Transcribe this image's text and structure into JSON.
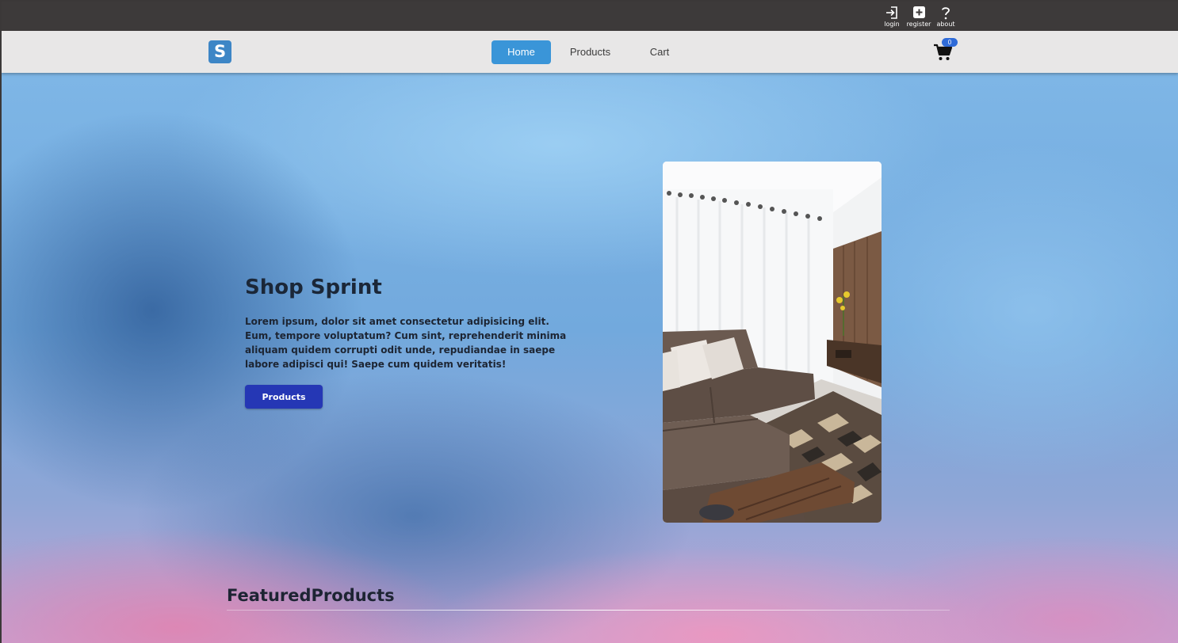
{
  "utility": {
    "login_label": "login",
    "register_label": "register",
    "about_label": "about"
  },
  "navbar": {
    "logo_letter": "S",
    "links": [
      {
        "label": "Home",
        "active": true
      },
      {
        "label": "Products",
        "active": false
      },
      {
        "label": "Cart",
        "active": false
      }
    ],
    "cart_count": "0"
  },
  "hero": {
    "title": "Shop Sprint",
    "text": "Lorem ipsum, dolor sit amet consectetur adipisicing elit. Eum, tempore voluptatum? Cum sint, reprehenderit minima aliquam quidem corrupti odit unde, repudiandae in saepe labore adipisci qui! Saepe cum quidem veritatis!",
    "button_label": "Products",
    "image_subject": "living-room-sofa-photo"
  },
  "featured": {
    "title": "FeaturedProducts"
  },
  "colors": {
    "topbar": "#3d3a3a",
    "navbar": "#e8e7e7",
    "nav_active": "#3a95d8",
    "logo": "#3d86c6",
    "button": "#2537b5",
    "badge": "#2f6bd8"
  },
  "icons": [
    "login-icon",
    "register-plus-icon",
    "question-icon",
    "cart-icon"
  ]
}
